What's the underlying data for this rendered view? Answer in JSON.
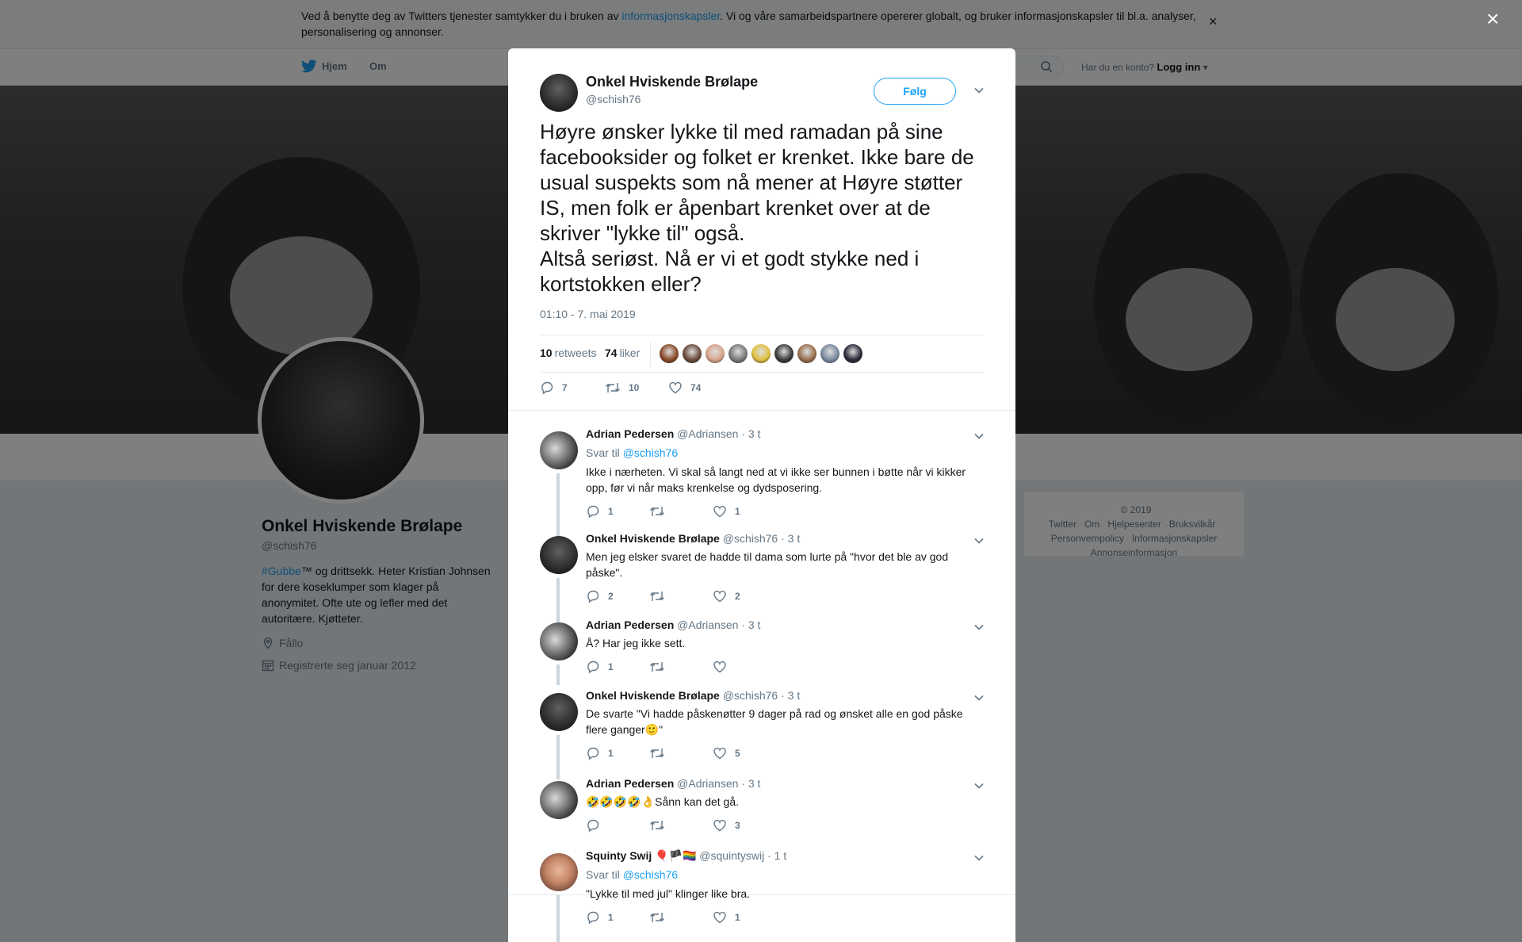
{
  "cookie_banner": {
    "text_before": "Ved å benytte deg av Twitters tjenester samtykker du i bruken av ",
    "link": "informasjonskapsler",
    "text_after": ". Vi og våre samarbeidspartnere opererer globalt, og bruker informasjonskapsler til bl.a. analyser, personalisering og annonser.",
    "close": "×"
  },
  "nav": {
    "home": "Hjem",
    "about": "Om",
    "account_prompt": "Har du en konto?",
    "login": "Logg inn"
  },
  "profile": {
    "name": "Onkel Hviskende Brølape",
    "handle": "@schish76",
    "bio_tag": "#Gubbe",
    "bio_rest": "™ og drittsekk. Heter Kristian Johnsen for dere koseklumper som klager på anonymitet. Ofte ute og lefler med det autoritære. Kjøtteter.",
    "location": "Fållo",
    "joined": "Registrerte seg januar 2012"
  },
  "footer": {
    "copyright": "© 2019 Twitter",
    "about": "Om",
    "help": "Hjelpesenter",
    "terms": "Bruksvilkår",
    "privacy": "Personvernpolicy",
    "cookies": "Informasjonskapsler",
    "ads": "Annonseinformasjon"
  },
  "overlay_close": "×",
  "main_tweet": {
    "name": "Onkel Hviskende Brølape",
    "handle": "@schish76",
    "follow_label": "Følg",
    "text": "Høyre ønsker lykke til med ramadan på sine facebooksider og folket er krenket. Ikke bare de usual suspekts som nå mener at Høyre støtter IS, men folk er åpenbart krenket over at de skriver \"lykke til\" også.\nAltså seriøst. Nå er vi et godt stykke ned i kortstokken eller?",
    "timestamp": "01:10 - 7. mai 2019",
    "retweets_count": "10",
    "retweets_label": "retweets",
    "likes_count": "74",
    "likes_label": "liker",
    "liker_colors": [
      "#8a4a2a",
      "#6b4a3a",
      "#d9a58a",
      "#7a7a7a",
      "#e0c040",
      "#3a3a3a",
      "#9a7050",
      "#7a8aa0",
      "#2a2a3a"
    ],
    "actions": {
      "replies": "7",
      "retweets": "10",
      "likes": "74"
    }
  },
  "replies": [
    {
      "name": "Adrian Pedersen",
      "handle": "@Adriansen",
      "time": "· 3 t",
      "reply_to_label": "Svar til",
      "reply_to_handle": "@schish76",
      "text": "Ikke i nærheten. Vi skal så langt ned at vi ikke ser bunnen i bøtte når vi kikker opp, før vi når maks krenkelse og dydsposering.",
      "replies": "1",
      "retweets": "",
      "likes": "1"
    },
    {
      "name": "Onkel Hviskende Brølape",
      "handle": "@schish76",
      "time": "· 3 t",
      "text": "Men jeg elsker svaret de hadde til dama som lurte på \"hvor det ble av god påske\".",
      "replies": "2",
      "retweets": "",
      "likes": "2"
    },
    {
      "name": "Adrian Pedersen",
      "handle": "@Adriansen",
      "time": "· 3 t",
      "text": "Å? Har jeg ikke sett.",
      "replies": "1",
      "retweets": "",
      "likes": ""
    },
    {
      "name": "Onkel Hviskende Brølape",
      "handle": "@schish76",
      "time": "· 3 t",
      "text": "De svarte \"Vi hadde påskenøtter 9 dager på rad og ønsket alle en god påske flere ganger🙂\"",
      "replies": "1",
      "retweets": "",
      "likes": "5"
    },
    {
      "name": "Adrian Pedersen",
      "handle": "@Adriansen",
      "time": "· 3 t",
      "text": "🤣🤣🤣🤣👌Sånn kan det gå.",
      "replies": "",
      "retweets": "",
      "likes": "3"
    },
    {
      "name": "Squinty Swij 🎈🏴🏳️‍🌈",
      "handle": "@squintyswij",
      "time": "· 1 t",
      "reply_to_label": "Svar til",
      "reply_to_handle": "@schish76",
      "text": "\"Lykke til med jul\" klinger like bra.",
      "replies": "1",
      "retweets": "",
      "likes": "1"
    }
  ],
  "colors": {
    "accent": "#1da1f2",
    "text_secondary": "#657786",
    "thread_line": "#ccd6dd"
  },
  "icons": [
    "twitter-bird-icon",
    "search-icon",
    "location-icon",
    "calendar-icon",
    "chevron-down-icon",
    "reply-icon",
    "retweet-icon",
    "like-icon",
    "close-icon"
  ]
}
